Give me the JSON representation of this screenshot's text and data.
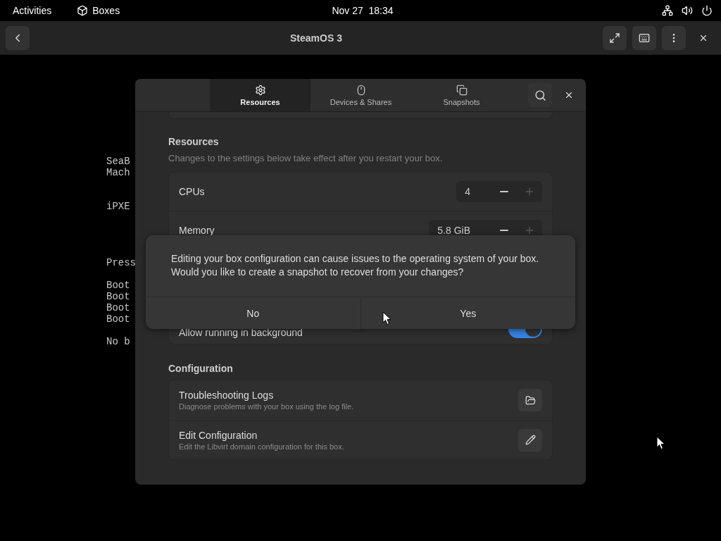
{
  "top_bar": {
    "activities": "Activities",
    "app": "Boxes",
    "clock": "Nov 27  18:34"
  },
  "header_bar": {
    "title": "SteamOS 3"
  },
  "console_blocks": [
    [
      "SeaB",
      "Mach"
    ],
    [
      "iPXE"
    ],
    [
      "Press"
    ],
    [
      "Boot",
      "Boot",
      "Boot",
      "Boot"
    ],
    [
      "No b"
    ]
  ],
  "preferences": {
    "tabs": [
      {
        "label": "Resources",
        "selected": true
      },
      {
        "label": "Devices & Shares",
        "selected": false
      },
      {
        "label": "Snapshots",
        "selected": false
      }
    ],
    "sections": [
      {
        "title": "Resources",
        "subtitle": "Changes to the settings below take effect after you restart your box.",
        "rows": [
          {
            "kind": "spin",
            "label": "CPUs",
            "value": "4",
            "plus_disabled": true
          },
          {
            "kind": "spin",
            "label": "Memory",
            "value": "5.8 GiB",
            "plus_disabled": true
          },
          {
            "kind": "switch",
            "label": "Allow running in background",
            "on": true
          }
        ]
      },
      {
        "title": "Configuration",
        "rows": [
          {
            "kind": "action",
            "label": "Troubleshooting Logs",
            "description": "Diagnose problems with your box using the log file."
          },
          {
            "kind": "action",
            "label": "Edit Configuration",
            "description": "Edit the Libvirt domain configuration for this box."
          }
        ]
      }
    ]
  },
  "dialog": {
    "message": "Editing your box configuration can cause issues to the operating system of your box.\nWould you like to create a snapshot to recover from your changes?",
    "buttons": [
      "No",
      "Yes"
    ]
  }
}
